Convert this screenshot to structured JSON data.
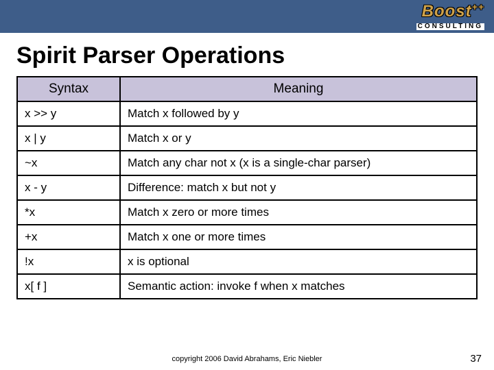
{
  "logo": {
    "brand_html": "Boost",
    "brand_sup": "++",
    "sub": "CONSULTING"
  },
  "title": "Spirit Parser Operations",
  "table": {
    "headers": {
      "syntax": "Syntax",
      "meaning": "Meaning"
    },
    "rows": [
      {
        "syntax": "x >> y",
        "meaning": "Match x followed by y"
      },
      {
        "syntax": "x | y",
        "meaning": "Match x or y"
      },
      {
        "syntax": "~x",
        "meaning": "Match any char not x (x is a single-char parser)"
      },
      {
        "syntax": "x - y",
        "meaning": "Difference: match x but not y"
      },
      {
        "syntax": "*x",
        "meaning": "Match x zero or more times"
      },
      {
        "syntax": "+x",
        "meaning": "Match x one or more times"
      },
      {
        "syntax": "!x",
        "meaning": "x is optional"
      },
      {
        "syntax": "x[ f ]",
        "meaning": "Semantic action: invoke f when x matches"
      }
    ]
  },
  "footer": "copyright 2006 David Abrahams, Eric Niebler",
  "page_number": "37"
}
